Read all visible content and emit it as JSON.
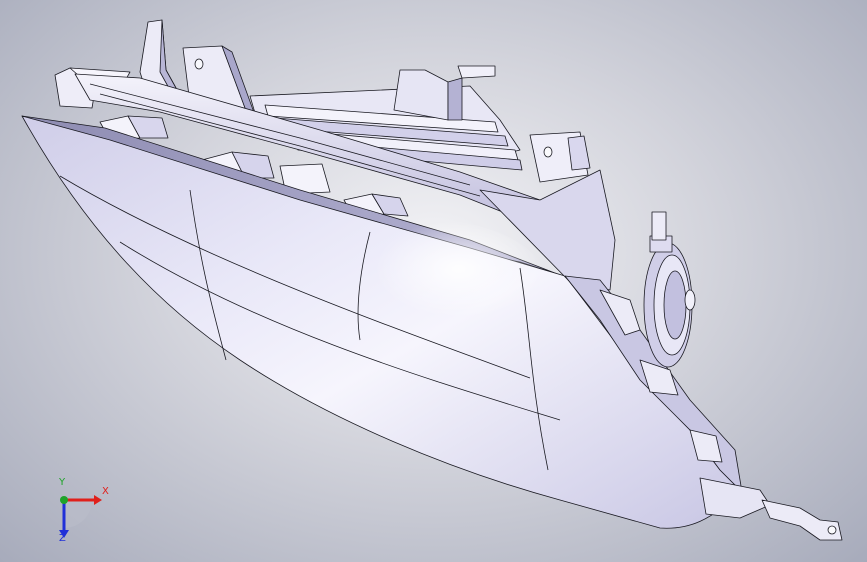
{
  "viewport": {
    "background_center_color": "#f3f3f6",
    "background_edge_color": "#a7abbb",
    "model_fill_color": "#e4e2f6",
    "model_shadow_color": "#9d9bc0",
    "edge_color": "#1a1a22"
  },
  "model": {
    "icon": "headlamp-3d-model"
  },
  "triad": {
    "x_label": "X",
    "y_label": "Y",
    "z_label": "Z",
    "x_color": "#e0201b",
    "y_color": "#1fa32a",
    "z_color": "#2030d8"
  }
}
